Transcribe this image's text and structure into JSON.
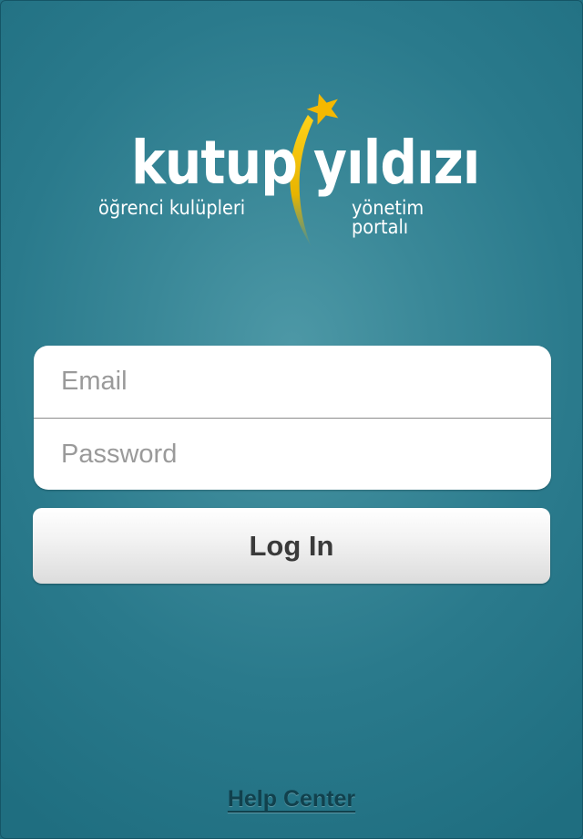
{
  "logo": {
    "word_left": "kutup",
    "word_right": "yıldızı",
    "subtitle_left": "öğrenci kulüpleri",
    "subtitle_right": "yönetim portalı",
    "star_color": "#f5b800"
  },
  "form": {
    "email_placeholder": "Email",
    "password_placeholder": "Password"
  },
  "login_button": {
    "label": "Log In"
  },
  "help": {
    "label": "Help Center"
  }
}
